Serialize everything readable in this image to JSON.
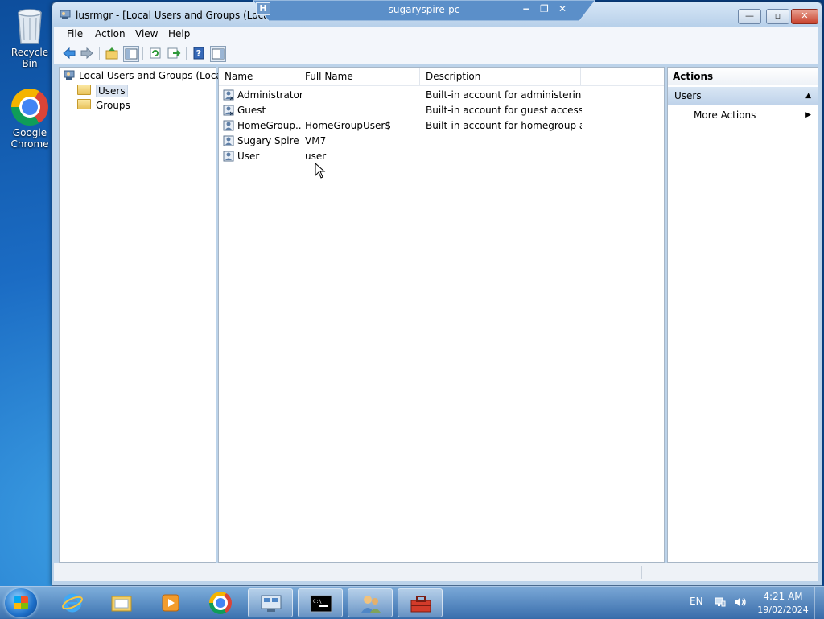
{
  "desktop": {
    "icons": [
      {
        "label": "Recycle Bin",
        "icon": "recycle-bin-icon"
      },
      {
        "label": "Google Chrome",
        "icon": "chrome-icon"
      }
    ]
  },
  "remote_bar": {
    "title": "sugaryspire-pc",
    "pin": "H",
    "min": "−",
    "restore": "❐",
    "close": "✕"
  },
  "window": {
    "title": "lusrmgr - [Local Users and Groups (Local)\\Users]",
    "buttons": {
      "minimize": "—",
      "maximize": "▫",
      "close": "✕"
    }
  },
  "menu": [
    "File",
    "Action",
    "View",
    "Help"
  ],
  "toolbar": [
    "back-icon",
    "forward-icon",
    "up-folder-icon",
    "show-hide-tree-icon",
    "refresh-icon",
    "export-list-icon",
    "help-icon",
    "show-hide-action-pane-icon"
  ],
  "tree": {
    "root": "Local Users and Groups (Local)",
    "children": [
      "Users",
      "Groups"
    ],
    "selected": "Users"
  },
  "list": {
    "columns": [
      "Name",
      "Full Name",
      "Description"
    ],
    "rows": [
      {
        "name": "Administrator",
        "full_name": "",
        "description": "Built-in account for administering..."
      },
      {
        "name": "Guest",
        "full_name": "",
        "description": "Built-in account for guest access t..."
      },
      {
        "name": "HomeGroup...",
        "full_name": "HomeGroupUser$",
        "description": "Built-in account for homegroup a..."
      },
      {
        "name": "Sugary Spire",
        "full_name": "VM7",
        "description": ""
      },
      {
        "name": "User",
        "full_name": "user",
        "description": ""
      }
    ]
  },
  "actions": {
    "header": "Actions",
    "section": "Users",
    "section_arrow": "▲",
    "items": [
      {
        "label": "More Actions",
        "arrow": "▶"
      }
    ]
  },
  "taskbar": {
    "apps": [
      "internet-explorer-icon",
      "windows-explorer-icon",
      "media-player-icon",
      "chrome-icon",
      "remote-desktop-icon",
      "command-prompt-icon",
      "local-users-icon",
      "toolbox-icon"
    ],
    "active_apps": [
      "local-users-icon"
    ],
    "tray": {
      "language": "EN",
      "time": "4:21 AM",
      "date": "19/02/2024"
    }
  },
  "colors": {
    "desktop": "#1b6cc4",
    "titlebar": "#c7dcf0",
    "actions_section": "#c9dbef",
    "taskbar": "#4c86c4",
    "close_button": "#c8412c"
  }
}
